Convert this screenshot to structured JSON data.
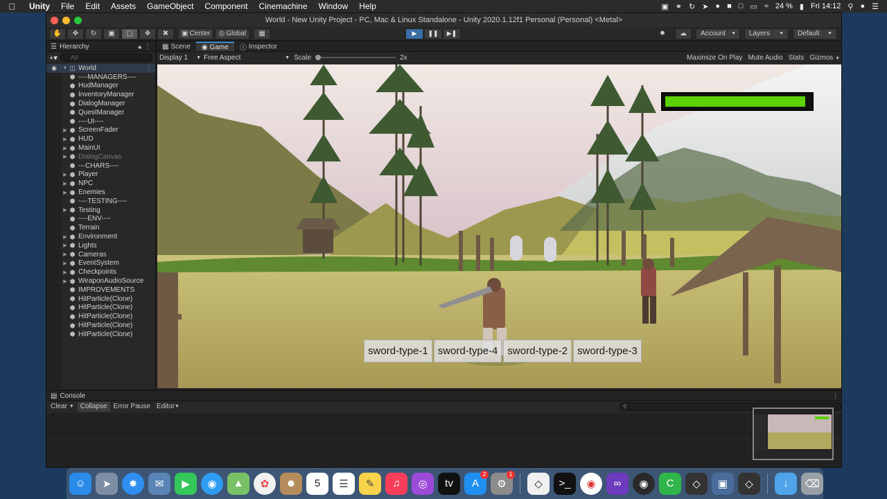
{
  "menubar": {
    "apple": "",
    "items": [
      "Unity",
      "File",
      "Edit",
      "Assets",
      "GameObject",
      "Component",
      "Cinemachine",
      "Window",
      "Help"
    ],
    "battery": "24 %",
    "clock": "Fri 14:12"
  },
  "window": {
    "title": "World - New Unity Project - PC, Mac & Linux Standalone - Unity 2020.1.12f1 Personal (Personal) <Metal>"
  },
  "toolbar": {
    "center_label": "Center",
    "global_label": "Global",
    "account_label": "Account",
    "layers_label": "Layers",
    "layout_label": "Default"
  },
  "hierarchy": {
    "tab_label": "Hierarchy",
    "search_placeholder": "All",
    "scene_name": "World",
    "items": [
      {
        "label": "----MANAGERS----",
        "expandable": false,
        "dim": false
      },
      {
        "label": "HudManager",
        "expandable": false,
        "dim": false
      },
      {
        "label": "InventoryManager",
        "expandable": false,
        "dim": false
      },
      {
        "label": "DialogManager",
        "expandable": false,
        "dim": false
      },
      {
        "label": "QuestManager",
        "expandable": false,
        "dim": false
      },
      {
        "label": "----UI----",
        "expandable": false,
        "dim": false
      },
      {
        "label": "ScreenFader",
        "expandable": true,
        "dim": false
      },
      {
        "label": "HUD",
        "expandable": true,
        "dim": false
      },
      {
        "label": "MainUI",
        "expandable": true,
        "dim": false
      },
      {
        "label": "DialogCanvas",
        "expandable": true,
        "dim": true
      },
      {
        "label": "---CHARS----",
        "expandable": false,
        "dim": false
      },
      {
        "label": "Player",
        "expandable": true,
        "dim": false
      },
      {
        "label": "NPC",
        "expandable": true,
        "dim": false
      },
      {
        "label": "Enemies",
        "expandable": true,
        "dim": false
      },
      {
        "label": "----TESTING----",
        "expandable": false,
        "dim": false
      },
      {
        "label": "Testing",
        "expandable": true,
        "dim": false
      },
      {
        "label": "----ENV----",
        "expandable": false,
        "dim": false
      },
      {
        "label": "Terrain",
        "expandable": false,
        "dim": false
      },
      {
        "label": "Environment",
        "expandable": true,
        "dim": false
      },
      {
        "label": "Lights",
        "expandable": true,
        "dim": false
      },
      {
        "label": "Cameras",
        "expandable": true,
        "dim": false
      },
      {
        "label": "EventSystem",
        "expandable": true,
        "dim": false
      },
      {
        "label": "Checkpoints",
        "expandable": true,
        "dim": false
      },
      {
        "label": "WeaponAudioSource",
        "expandable": true,
        "dim": false
      },
      {
        "label": "IMPROVEMENTS",
        "expandable": false,
        "dim": false
      },
      {
        "label": "HitParticle(Clone)",
        "expandable": false,
        "dim": false
      },
      {
        "label": "HitParticle(Clone)",
        "expandable": false,
        "dim": false
      },
      {
        "label": "HitParticle(Clone)",
        "expandable": false,
        "dim": false
      },
      {
        "label": "HitParticle(Clone)",
        "expandable": false,
        "dim": false
      },
      {
        "label": "HitParticle(Clone)",
        "expandable": false,
        "dim": false
      }
    ]
  },
  "tabs": {
    "scene": "Scene",
    "game": "Game",
    "inspector": "Inspector"
  },
  "game_bar": {
    "display": "Display 1",
    "aspect": "Free Aspect",
    "scale_label": "Scale",
    "scale_value": "2x",
    "maximize": "Maximize On Play",
    "mute": "Mute Audio",
    "stats": "Stats",
    "gizmos": "Gizmos"
  },
  "hud": {
    "health_fraction": 0.97,
    "health_color": "#5bd106",
    "sword_buttons": [
      "sword-type-1",
      "sword-type-4",
      "sword-type-2",
      "sword-type-3"
    ]
  },
  "console": {
    "tab_label": "Console",
    "clear": "Clear",
    "collapse": "Collapse",
    "error_pause": "Error Pause",
    "editor": "Editor",
    "count_warn": "0",
    "count_err": "0"
  },
  "dock": {
    "calendar_day": "5",
    "appstore_badge": "2",
    "prefs_badge": "1"
  }
}
